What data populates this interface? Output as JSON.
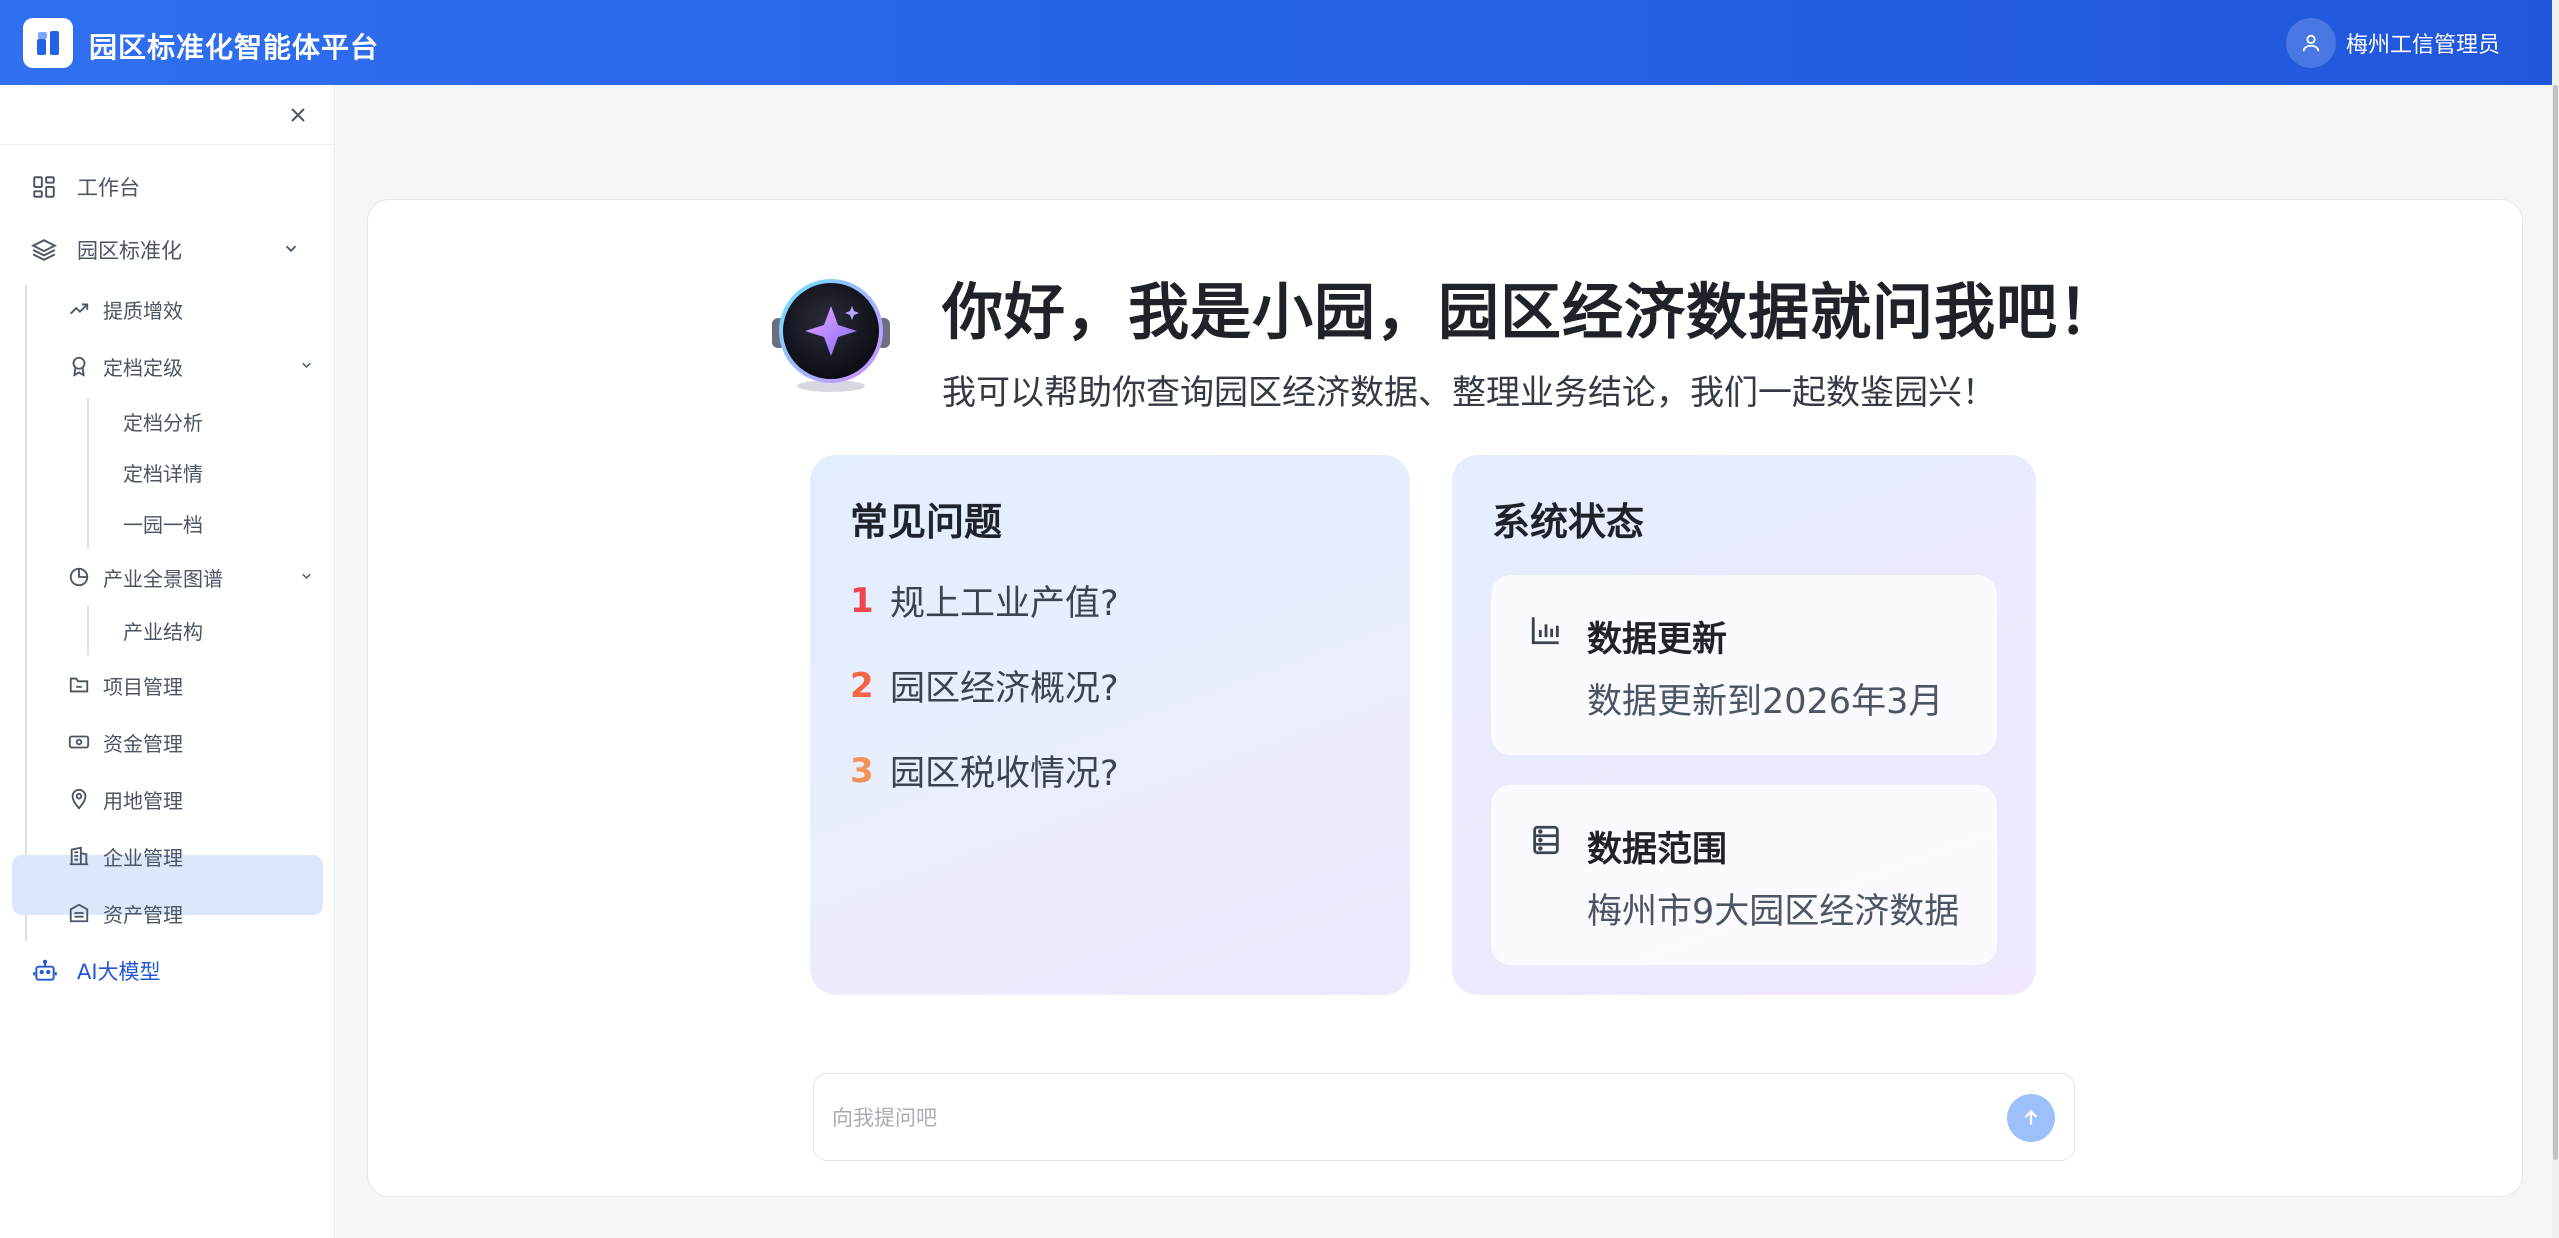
{
  "header": {
    "app_title": "园区标准化智能体平台",
    "user_name": "梅州工信管理员"
  },
  "sidebar": {
    "items": [
      {
        "label": "工作台",
        "icon": "dashboard-icon"
      },
      {
        "label": "园区标准化",
        "icon": "layers-icon",
        "expanded": true
      },
      {
        "label": "提质增效",
        "icon": "trend-up-icon"
      },
      {
        "label": "定档定级",
        "icon": "award-icon",
        "expanded": true
      },
      {
        "label": "定档分析"
      },
      {
        "label": "定档详情"
      },
      {
        "label": "一园一档"
      },
      {
        "label": "产业全景图谱",
        "icon": "pie-chart-icon",
        "expanded": true
      },
      {
        "label": "产业结构"
      },
      {
        "label": "项目管理",
        "icon": "folder-icon"
      },
      {
        "label": "资金管理",
        "icon": "money-icon"
      },
      {
        "label": "用地管理",
        "icon": "location-icon"
      },
      {
        "label": "企业管理",
        "icon": "building-icon"
      },
      {
        "label": "资产管理",
        "icon": "archive-icon"
      },
      {
        "label": "AI大模型",
        "icon": "robot-icon",
        "active": true
      }
    ]
  },
  "main": {
    "greeting_title": "你好，我是小园，园区经济数据就问我吧！",
    "greeting_subtitle": "我可以帮助你查询园区经济数据、整理业务结论，我们一起数鉴园兴！",
    "faq": {
      "title": "常见问题",
      "items": [
        {
          "num": "1",
          "text": "规上工业产值?",
          "color": "#f0454a"
        },
        {
          "num": "2",
          "text": "园区经济概况?",
          "color": "#f26645"
        },
        {
          "num": "3",
          "text": "园区税收情况?",
          "color": "#f2935a"
        }
      ]
    },
    "status": {
      "title": "系统状态",
      "cards": [
        {
          "title": "数据更新",
          "desc": "数据更新到2026年3月",
          "icon": "bar-chart-icon"
        },
        {
          "title": "数据范围",
          "desc": "梅州市9大园区经济数据",
          "icon": "server-icon"
        }
      ]
    },
    "ask": {
      "placeholder": "向我提问吧",
      "value": ""
    }
  },
  "colors": {
    "header_blue": "#2563e6",
    "active_bg": "#dbe8fc",
    "active_text": "#2457d6",
    "send_button": "#9dc0fb"
  }
}
